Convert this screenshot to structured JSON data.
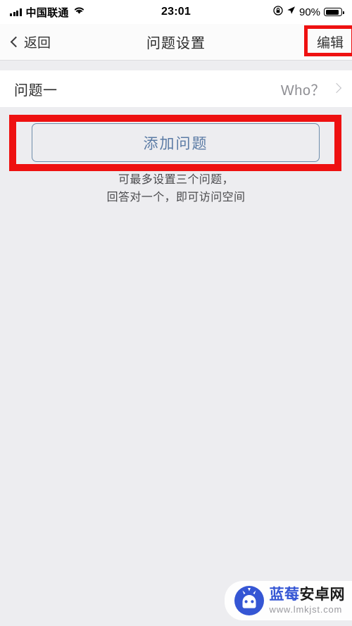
{
  "status_bar": {
    "carrier": "中国联通",
    "time": "23:01",
    "battery_percent": "90%",
    "icons": [
      "signal-bars-icon",
      "wifi-icon",
      "rotation-lock-icon",
      "location-arrow-icon",
      "battery-icon"
    ]
  },
  "nav_bar": {
    "back_label": "返回",
    "title": "问题设置",
    "edit_label": "编辑"
  },
  "question_row": {
    "label": "问题一",
    "value": "Who？"
  },
  "add_button": {
    "label": "添加问题"
  },
  "hint": {
    "line1": "可最多设置三个问题，",
    "line2": "回答对一个，即可访问空间"
  },
  "watermark": {
    "name_blue": "蓝莓",
    "name_dark": "安卓网",
    "url": "www.lmkjst.com"
  },
  "colors": {
    "highlight_red": "#ee1111",
    "accent_blue": "#5b7ba5",
    "button_border": "#6e8cab",
    "background_gray": "#ededf0",
    "card_white": "#ffffff",
    "value_gray": "#8e8e93",
    "brand_blue": "#3556d4"
  }
}
